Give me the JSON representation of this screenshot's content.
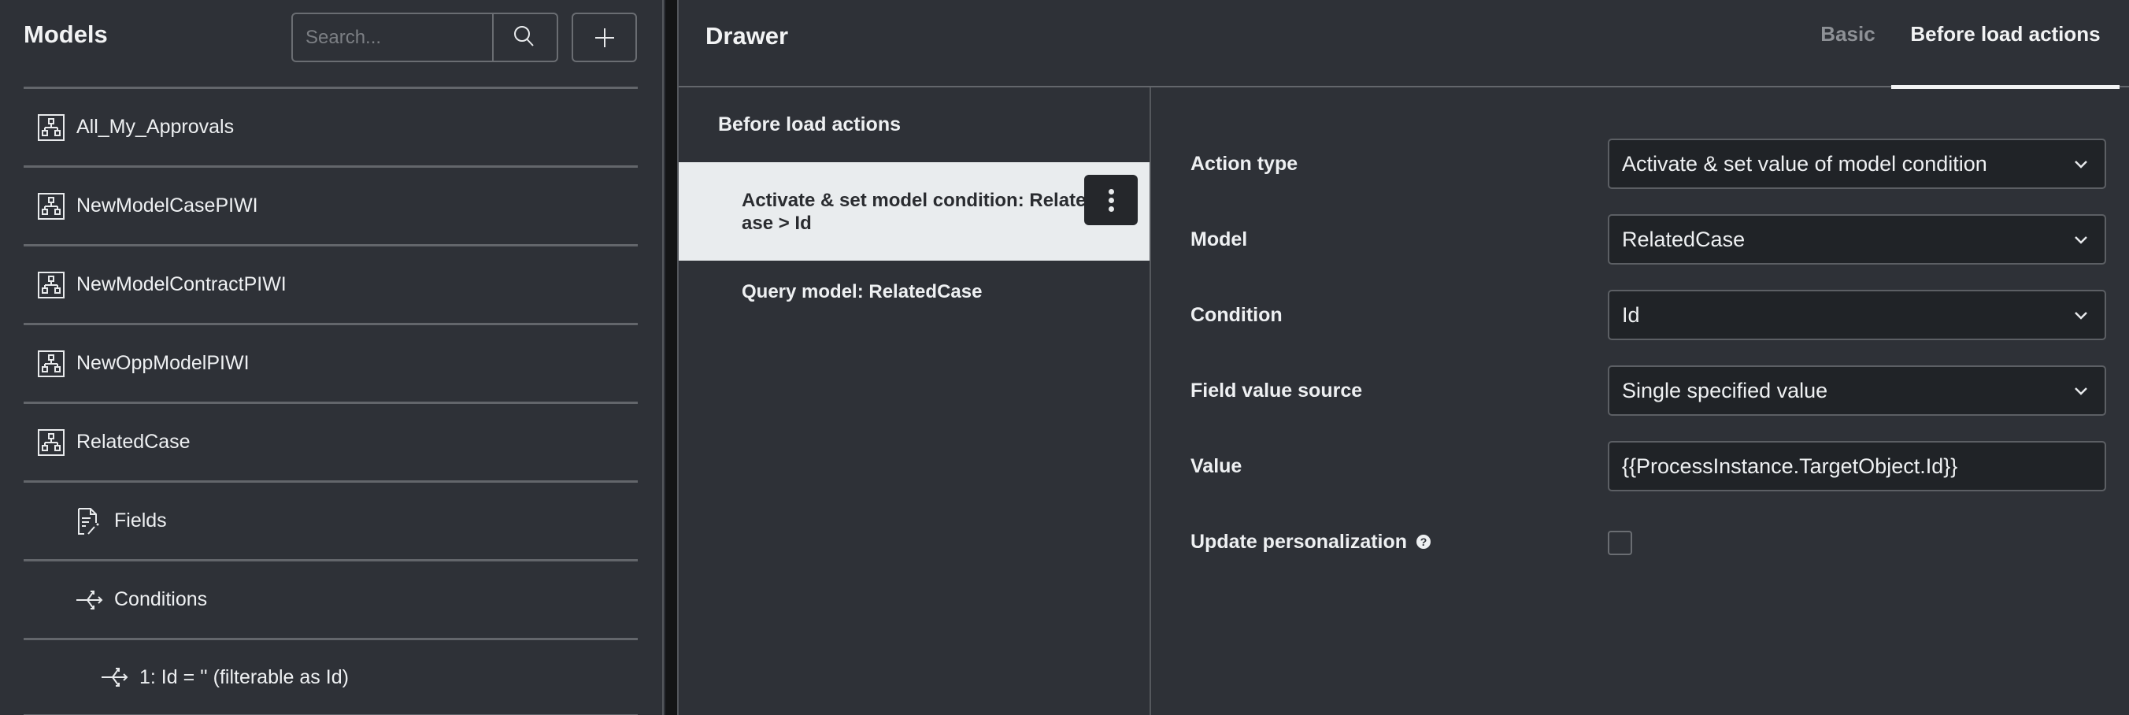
{
  "models_panel": {
    "title": "Models",
    "search": {
      "placeholder": "Search...",
      "value": ""
    },
    "search_button_icon": "search-icon",
    "add_button_icon": "plus-icon",
    "tree": [
      {
        "label": "All_My_Approvals",
        "icon": "model-hierarchy-icon",
        "level": 0
      },
      {
        "label": "NewModelCasePIWI",
        "icon": "model-hierarchy-icon",
        "level": 0
      },
      {
        "label": "NewModelContractPIWI",
        "icon": "model-hierarchy-icon",
        "level": 0
      },
      {
        "label": "NewOppModelPIWI",
        "icon": "model-hierarchy-icon",
        "level": 0
      },
      {
        "label": "RelatedCase",
        "icon": "model-hierarchy-icon",
        "level": 0
      },
      {
        "label": "Fields",
        "icon": "document-edit-icon",
        "level": 1
      },
      {
        "label": "Conditions",
        "icon": "branch-icon",
        "level": 1
      },
      {
        "label": "1: Id = '' (filterable as Id)",
        "icon": "branch-icon",
        "level": 2
      }
    ]
  },
  "drawer": {
    "title": "Drawer",
    "tabs": [
      {
        "label": "Basic",
        "active": false
      },
      {
        "label": "Before load actions",
        "active": true
      }
    ],
    "actions": {
      "heading": "Before load actions",
      "items": [
        {
          "label": "Activate & set model condition: RelatedCase > Id",
          "selected": true
        },
        {
          "label": "Query model: RelatedCase",
          "selected": false
        }
      ],
      "menu_icon": "more-vertical-icon"
    },
    "form": {
      "action_type": {
        "label": "Action type",
        "value": "Activate & set value of model condition"
      },
      "model": {
        "label": "Model",
        "value": "RelatedCase"
      },
      "condition": {
        "label": "Condition",
        "value": "Id"
      },
      "field_value_source": {
        "label": "Field value source",
        "value": "Single specified value"
      },
      "value": {
        "label": "Value",
        "value": "{{ProcessInstance.TargetObject.Id}}"
      },
      "update_personalization": {
        "label": "Update personalization",
        "checked": false,
        "help_icon": "?"
      }
    }
  },
  "colors": {
    "background": "#2e3137",
    "selected_row": "#e9ecee",
    "input_bg": "#202327",
    "border": "#63666b",
    "text": "#eef0f2",
    "muted_tab": "#8e9196"
  }
}
